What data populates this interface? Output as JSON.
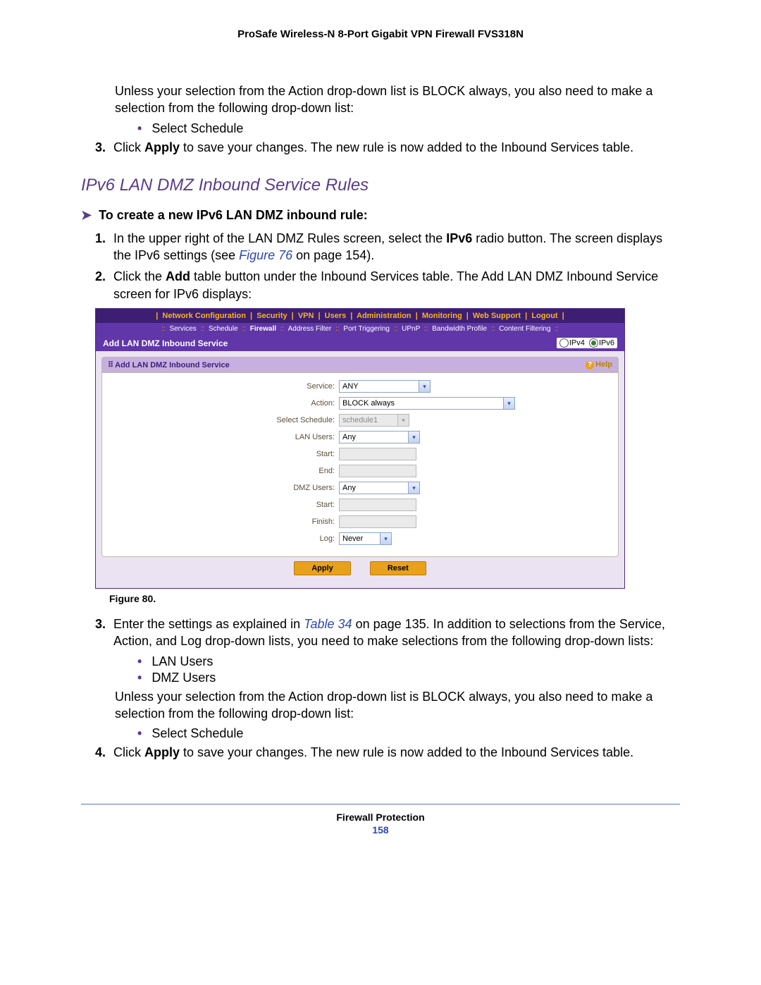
{
  "doc_header": "ProSafe Wireless-N 8-Port Gigabit VPN Firewall FVS318N",
  "intro_para": "Unless your selection from the Action drop-down list is BLOCK always, you also need to make a selection from the following drop-down list:",
  "bullet_select_schedule": "Select Schedule",
  "step3_prefix": "3.",
  "step3_a": "Click ",
  "step3_apply": "Apply",
  "step3_b": " to save your changes. The new rule is now added to the Inbound Services table.",
  "section_title": "IPv6 LAN DMZ Inbound Service Rules",
  "arrow_line": "To create a new IPv6 LAN DMZ inbound rule:",
  "s1_prefix": "1.",
  "s1_a": "In the upper right of the LAN DMZ Rules screen, select the ",
  "s1_ipv6": "IPv6",
  "s1_b": " radio button. The screen displays the IPv6 settings (see ",
  "s1_fig": "Figure 76",
  "s1_c": " on page 154).",
  "s2_prefix": "2.",
  "s2_a": "Click the ",
  "s2_add": "Add",
  "s2_b": " table button under the Inbound Services table. The Add LAN DMZ Inbound Service screen for IPv6 displays:",
  "ui": {
    "menu": [
      "Network Configuration",
      "Security",
      "VPN",
      "Users",
      "Administration",
      "Monitoring",
      "Web Support",
      "Logout"
    ],
    "submenu": [
      "Services",
      "Schedule",
      "Firewall",
      "Address Filter",
      "Port Triggering",
      "UPnP",
      "Bandwidth Profile",
      "Content Filtering"
    ],
    "submenu_active_index": 2,
    "titlebar": "Add LAN DMZ Inbound Service",
    "ipv4_label": "IPv4",
    "ipv6_label": "IPv6",
    "panel_title": "Add LAN DMZ Inbound Service",
    "help_label": "Help",
    "fields": {
      "service_label": "Service:",
      "service_value": "ANY",
      "action_label": "Action:",
      "action_value": "BLOCK always",
      "schedule_label": "Select Schedule:",
      "schedule_value": "schedule1",
      "lanusers_label": "LAN Users:",
      "lanusers_value": "Any",
      "start_label": "Start:",
      "end_label": "End:",
      "dmzusers_label": "DMZ Users:",
      "dmzusers_value": "Any",
      "start2_label": "Start:",
      "finish_label": "Finish:",
      "log_label": "Log:",
      "log_value": "Never"
    },
    "apply_btn": "Apply",
    "reset_btn": "Reset"
  },
  "figure_caption": "Figure 80.",
  "s3b_prefix": "3.",
  "s3b_a": "Enter the settings as explained in ",
  "s3b_table": "Table 34",
  "s3b_b": " on page 135. In addition to selections from the Service, Action, and Log drop-down lists, you need to make selections from the following drop-down lists:",
  "bul_lan": "LAN Users",
  "bul_dmz": "DMZ Users",
  "para_unless2": "Unless your selection from the Action drop-down list is BLOCK always, you also need to make a selection from the following drop-down list:",
  "s4_prefix": "4.",
  "s4_a": "Click ",
  "s4_apply": "Apply",
  "s4_b": " to save your changes. The new rule is now added to the Inbound Services table.",
  "footer_label": "Firewall Protection",
  "footer_page": "158"
}
